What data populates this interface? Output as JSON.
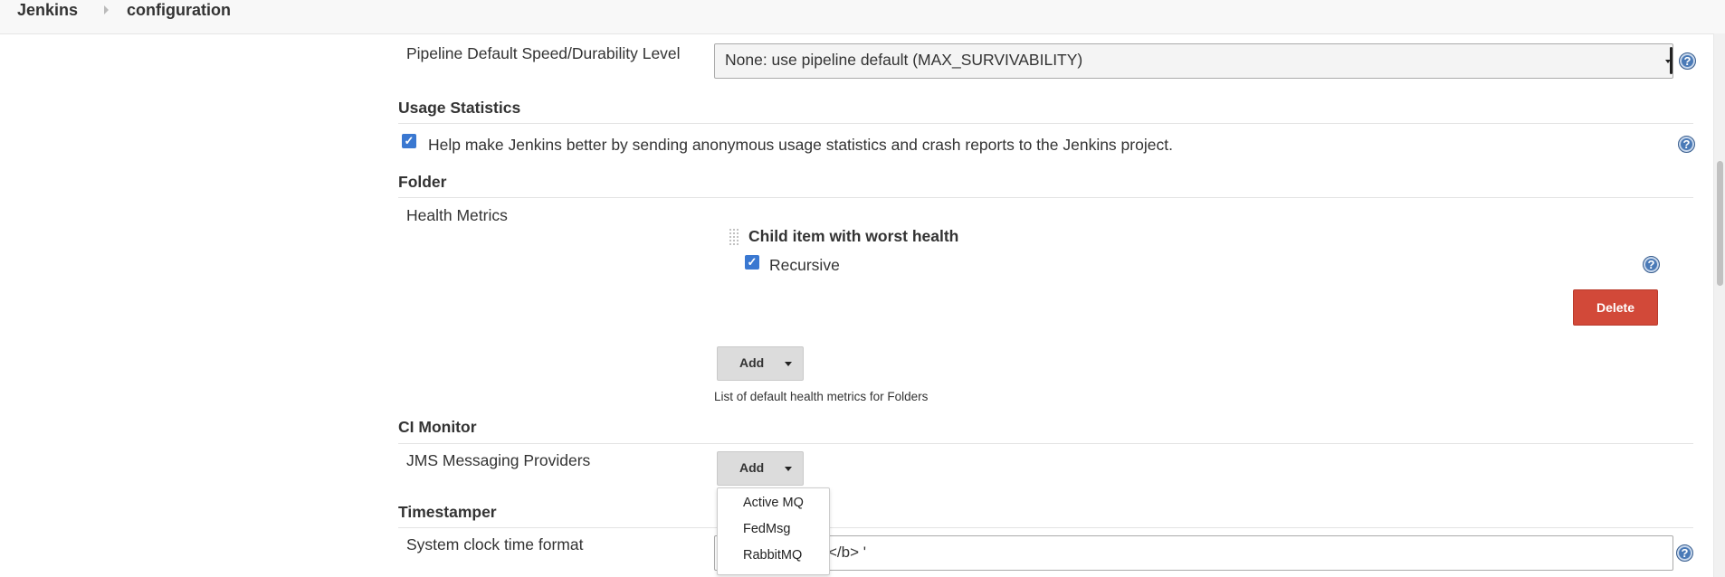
{
  "breadcrumb": {
    "items": [
      "Jenkins",
      "configuration"
    ]
  },
  "pipeline": {
    "label": "Pipeline Default Speed/Durability Level",
    "select_value": "None: use pipeline default (MAX_SURVIVABILITY)"
  },
  "usage_statistics": {
    "title": "Usage Statistics",
    "checkbox_label": "Help make Jenkins better by sending anonymous usage statistics and crash reports to the Jenkins project.",
    "checked": true
  },
  "folder": {
    "title": "Folder",
    "health_metrics_label": "Health Metrics",
    "metric_title": "Child item with worst health",
    "recursive_label": "Recursive",
    "recursive_checked": true,
    "delete_label": "Delete",
    "add_label": "Add",
    "description": "List of default health metrics for Folders"
  },
  "ci_monitor": {
    "title": "CI Monitor",
    "jms_label": "JMS Messaging Providers",
    "add_label": "Add",
    "dropdown_options": [
      "Active MQ",
      "FedMsg",
      "RabbitMQ"
    ]
  },
  "timestamper": {
    "title": "Timestamper",
    "clock_label": "System clock time format",
    "input_value_visible": "</b> '"
  },
  "colors": {
    "delete_button": "#d24939",
    "help_icon": "#4a7ab7",
    "checkbox": "#3a78d1",
    "add_button": "#dcdcdc"
  },
  "icons": [
    "help-icon",
    "checkbox-checked-icon",
    "drag-handle-icon",
    "caret-down-icon",
    "breadcrumb-separator-icon"
  ]
}
